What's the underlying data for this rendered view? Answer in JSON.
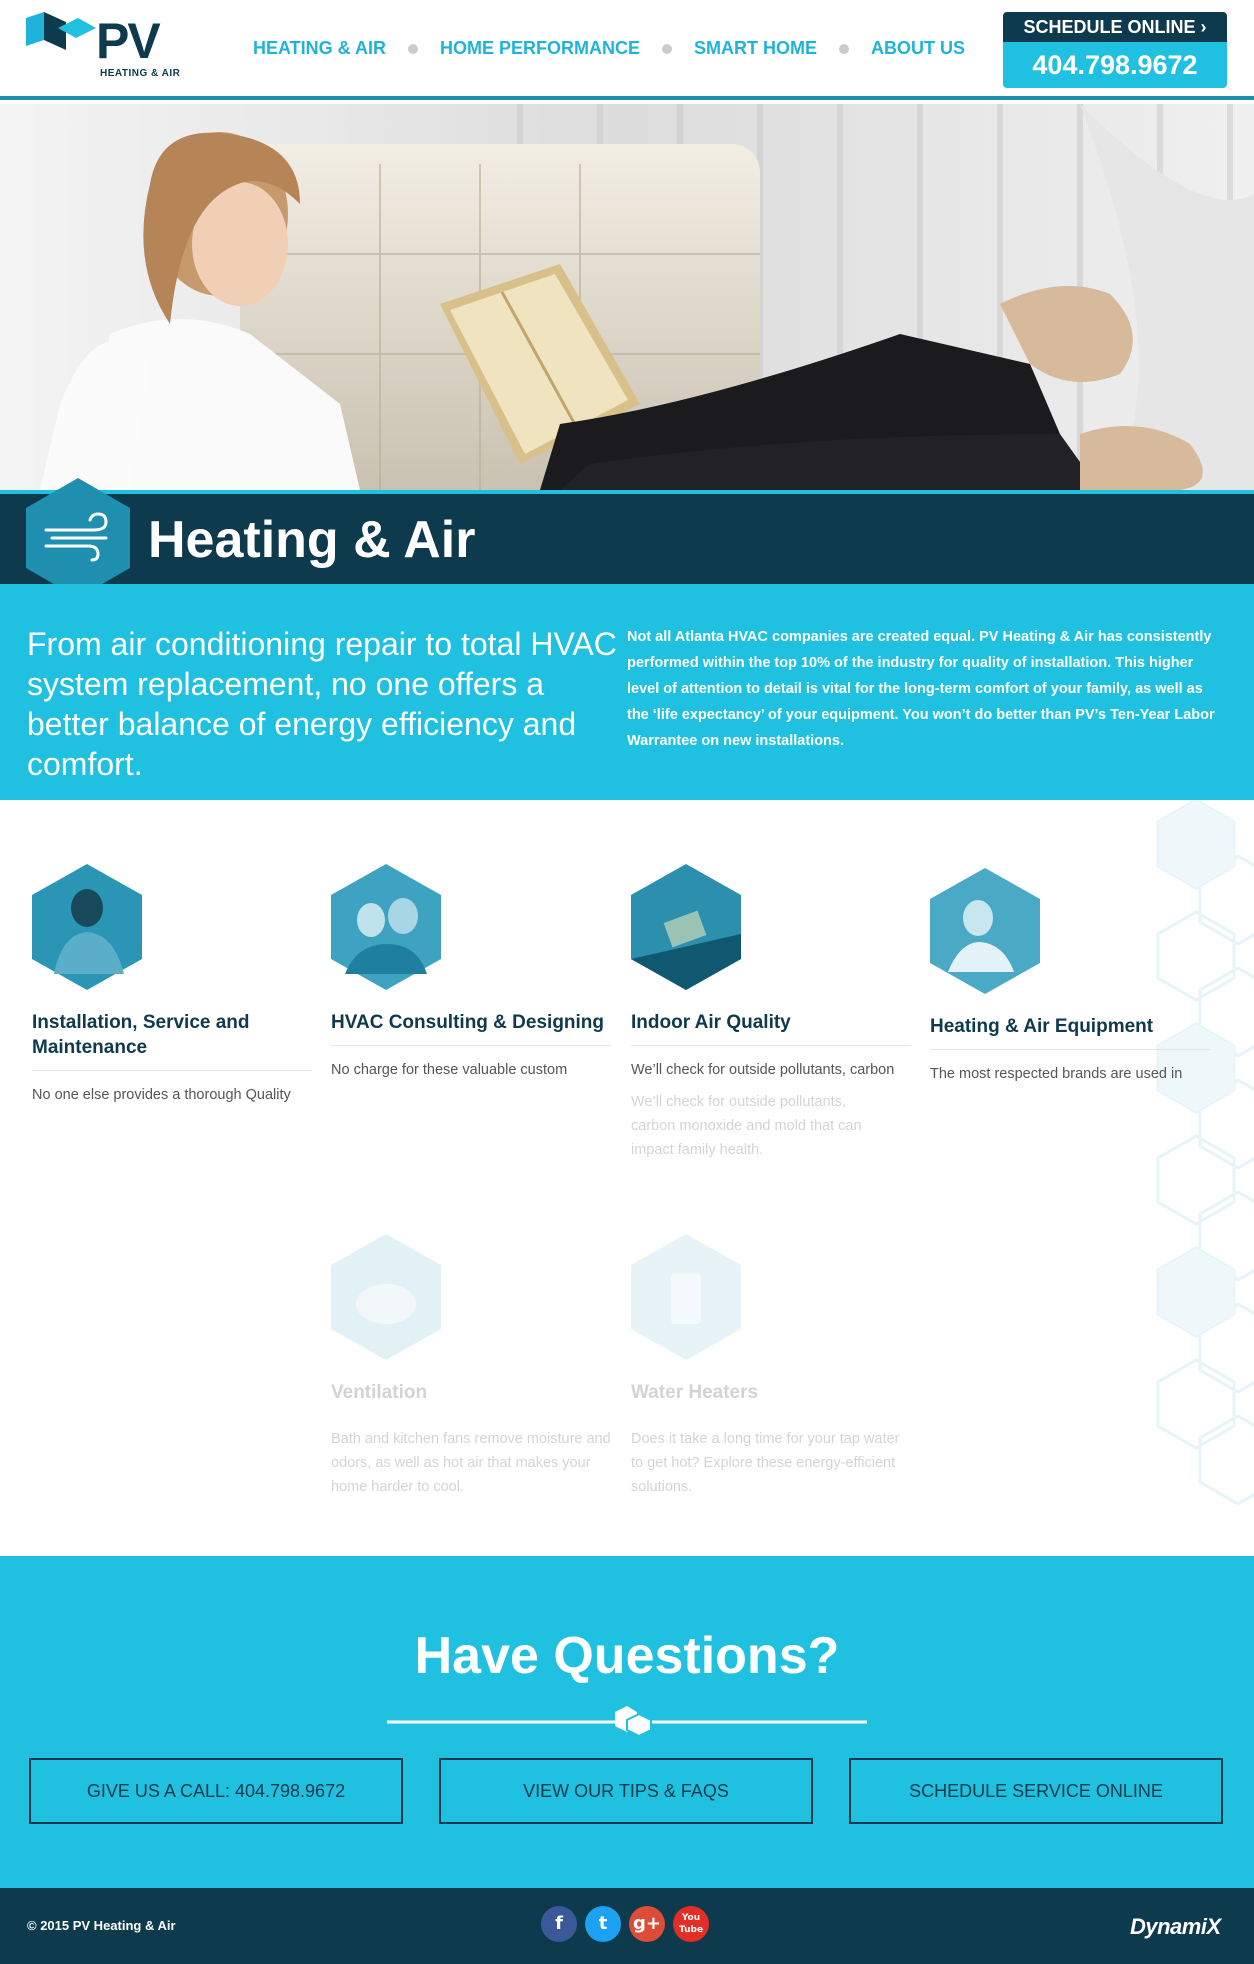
{
  "header": {
    "logo_text": "PV",
    "logo_sub": "HEATING & AIR",
    "nav": [
      {
        "label": "HEATING & AIR"
      },
      {
        "label": "HOME PERFORMANCE"
      },
      {
        "label": "SMART HOME"
      },
      {
        "label": "ABOUT US"
      }
    ],
    "schedule_label": "SCHEDULE ONLINE",
    "phone": "404.798.9672"
  },
  "page_title": "Heating & Air",
  "intro": {
    "lead": "From air conditioning repair to total HVAC system replacement, no one offers a better balance of energy efficiency and comfort.",
    "body": "Not all Atlanta HVAC companies are created equal. PV Heating & Air has consistently performed within the top 10% of the industry for quality of installation. This higher level of attention to detail is vital for the long-term comfort of your family, as well as the ‘life expectancy’ of your equipment. You won’t do better than PV’s Ten-Year Labor Warrantee on new installations."
  },
  "services": [
    {
      "title": "Installation, Service and Maintenance",
      "text": "No one else provides a thorough Quality"
    },
    {
      "title": "HVAC Consulting & Designing",
      "text": "No charge for these valuable custom services if you buy your system from PV"
    },
    {
      "title": "Indoor Air Quality",
      "text": "We’ll check for outside pollutants, carbon monoxide and mold that can"
    },
    {
      "title": "Heating & Air Equipment",
      "text": "The most respected brands are used in"
    },
    {
      "title": "Ventilation",
      "text": "Bath and kitchen fans remove moisture and odors, as well as hot air that makes your home harder to cool."
    },
    {
      "title": "Water Heaters",
      "text": "Does it take a long time for your tap water to get hot? Explore these energy-efficient solutions."
    }
  ],
  "ghost_text": "We’ll check for outside pollutants, carbon monoxide and mold that can impact family health.",
  "questions": {
    "title": "Have Questions?",
    "buttons": [
      {
        "label": "GIVE US A CALL: 404.798.9672"
      },
      {
        "label": "VIEW OUR TIPS & FAQS"
      },
      {
        "label": "SCHEDULE SERVICE ONLINE"
      }
    ]
  },
  "footer": {
    "copyright": "© 2015 PV Heating & Air",
    "social": [
      "facebook-icon",
      "twitter-icon",
      "google-plus-icon",
      "youtube-icon"
    ],
    "brand": "DynamiX"
  },
  "colors": {
    "navy": "#0d3a4c",
    "cyan": "#20c0e0",
    "nav_blue": "#20b3d9"
  }
}
